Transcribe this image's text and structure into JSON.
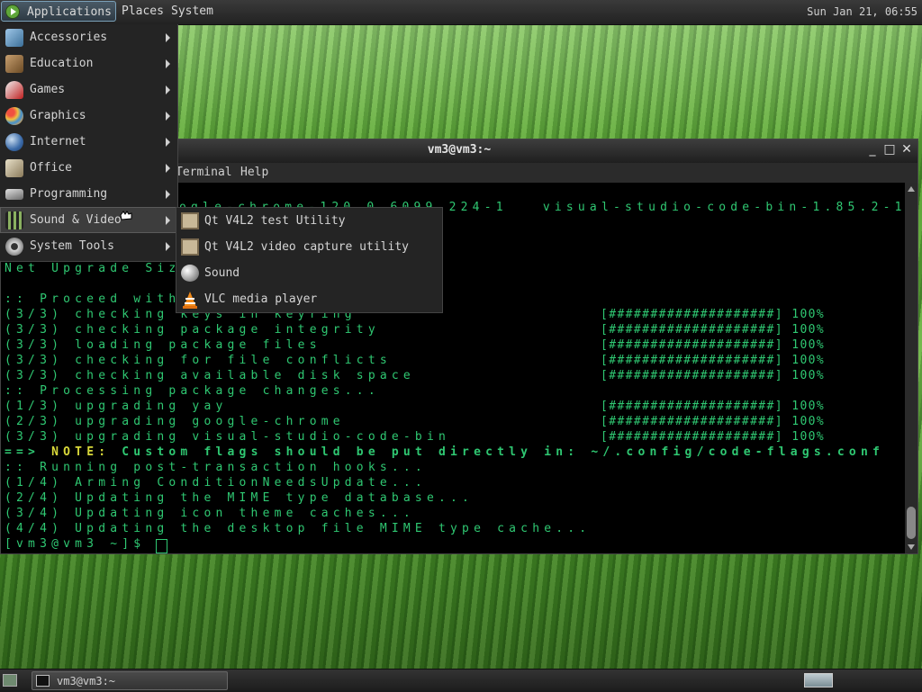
{
  "top_panel": {
    "applications": "Applications",
    "places": "Places",
    "system": "System",
    "clock": "Sun Jan 21, 06:55"
  },
  "terminal": {
    "title": "vm3@vm3:~",
    "menubar_partial": "Terminal",
    "menubar_help": "Help",
    "lines": [
      {
        "text": "ogle-chrome-120.0.6099.224-1   visual-studio-code-bin-1.85.2-1",
        "progress": ""
      },
      {
        "text": "Net Upgrade Siz",
        "progress": ""
      },
      {
        "text": ":: Proceed with",
        "progress": ""
      },
      {
        "text": "(3/3) checking keys in keyring",
        "progress": "[####################] 100%"
      },
      {
        "text": "(3/3) checking package integrity",
        "progress": "[####################] 100%"
      },
      {
        "text": "(3/3) loading package files",
        "progress": "[####################] 100%"
      },
      {
        "text": "(3/3) checking for file conflicts",
        "progress": "[####################] 100%"
      },
      {
        "text": "(3/3) checking available disk space",
        "progress": "[####################] 100%"
      },
      {
        "text": ":: Processing package changes...",
        "progress": ""
      },
      {
        "text": "(1/3) upgrading yay",
        "progress": "[####################] 100%"
      },
      {
        "text": "(2/3) upgrading google-chrome",
        "progress": "[####################] 100%"
      },
      {
        "text": "(3/3) upgrading visual-studio-code-bin",
        "progress": "[####################] 100%"
      },
      {
        "text": ":: Running post-transaction hooks...",
        "progress": ""
      },
      {
        "text": "(1/4) Arming ConditionNeedsUpdate...",
        "progress": ""
      },
      {
        "text": "(2/4) Updating the MIME type database...",
        "progress": ""
      },
      {
        "text": "(3/4) Updating icon theme caches...",
        "progress": ""
      },
      {
        "text": "(4/4) Updating the desktop file MIME type cache...",
        "progress": ""
      },
      {
        "text": "[vm3@vm3 ~]$ ",
        "progress": ""
      }
    ],
    "note_prefix": "==> ",
    "note_label": "NOTE:",
    "note_text": " Custom flags should be put directly in: ~/.config/code-flags.conf"
  },
  "app_menu": {
    "items": [
      {
        "label": "Accessories",
        "icon": "accessories-icon",
        "color": "#7fb2d6"
      },
      {
        "label": "Education",
        "icon": "education-icon",
        "color": "#8a6a3a"
      },
      {
        "label": "Games",
        "icon": "games-icon",
        "color": "#c03030"
      },
      {
        "label": "Graphics",
        "icon": "graphics-icon",
        "color": "#d0a040"
      },
      {
        "label": "Internet",
        "icon": "internet-icon",
        "color": "#4a78b8"
      },
      {
        "label": "Office",
        "icon": "office-icon",
        "color": "#b0a080"
      },
      {
        "label": "Programming",
        "icon": "programming-icon",
        "color": "#9a9a9a"
      },
      {
        "label": "Sound & Video",
        "icon": "sound-video-icon",
        "color": "#6a8a50"
      },
      {
        "label": "System Tools",
        "icon": "system-tools-icon",
        "color": "#8c8c8c"
      }
    ]
  },
  "submenu": {
    "items": [
      {
        "label": "Qt V4L2 test Utility",
        "icon": "qv4l2-icon"
      },
      {
        "label": "Qt V4L2 video capture utility",
        "icon": "qvidcap-icon"
      },
      {
        "label": "Sound",
        "icon": "sound-icon"
      },
      {
        "label": "VLC media player",
        "icon": "vlc-icon"
      }
    ]
  },
  "bottom_panel": {
    "task_label": "vm3@vm3:~"
  }
}
